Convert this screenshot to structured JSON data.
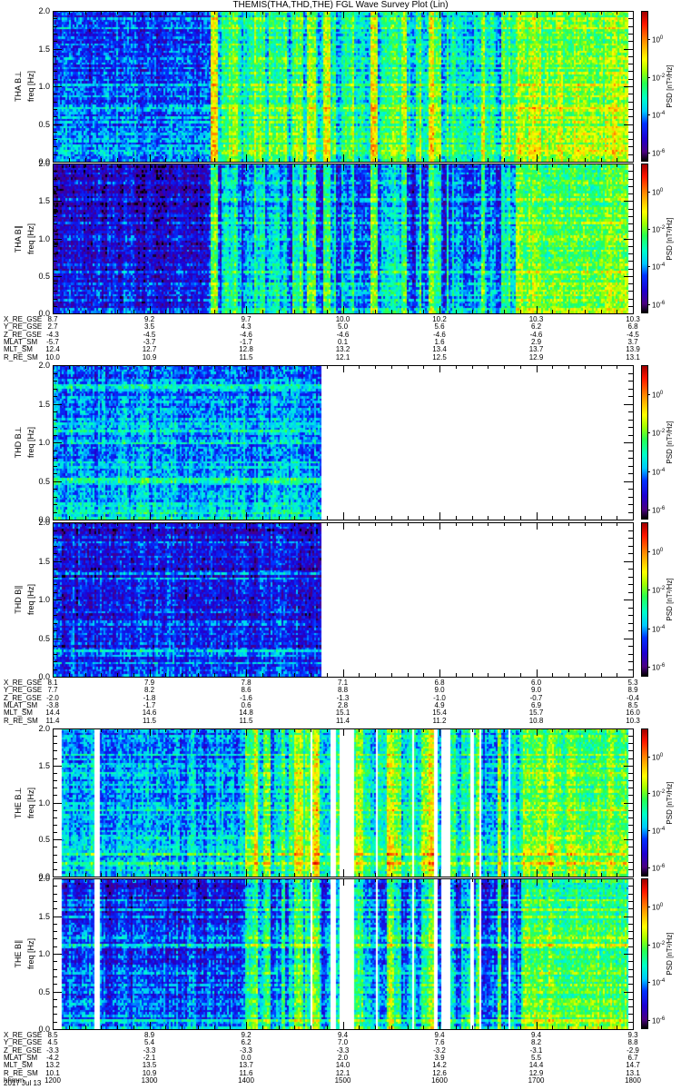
{
  "chart_data": {
    "type": "heatmap",
    "title": "THEMIS(THA,THD,THE) FGL Wave Survey Plot (Lin)",
    "xlabel": "hhmm",
    "date": "2017 Jul 13",
    "x_range_hours": [
      12.0,
      18.0
    ],
    "x_ticks": [
      "1200",
      "1300",
      "1400",
      "1500",
      "1600",
      "1700",
      "1800"
    ],
    "colorbar": {
      "label": "PSD [nT²/Hz]",
      "log10_range": [
        -6.5,
        1.5
      ],
      "ticks": [
        {
          "exp": "0",
          "value": 0
        },
        {
          "exp": "-2",
          "value": -2
        },
        {
          "exp": "-4",
          "value": -4
        },
        {
          "exp": "-6",
          "value": -6
        }
      ]
    },
    "panels": [
      {
        "probe": "THA",
        "ylabel": "THA B⊥",
        "unit_label": "freq [Hz]",
        "ylim": [
          0,
          2
        ],
        "yticks": [
          "0.0",
          "0.5",
          "1.0",
          "1.5",
          "2.0"
        ],
        "segments": [
          {
            "start": 12.0,
            "end": 13.63,
            "level": -4.8,
            "spread": 0.3
          },
          {
            "start": 13.63,
            "end": 16.78,
            "level": -2.9,
            "spread": 1.4
          },
          {
            "start": 16.78,
            "end": 17.95,
            "level": -2.3,
            "spread": 0.4
          }
        ]
      },
      {
        "probe": "THA",
        "ylabel": "THA B∥",
        "unit_label": "freq [Hz]",
        "ylim": [
          0,
          2
        ],
        "yticks": [
          "0.0",
          "0.5",
          "1.0",
          "1.5",
          "2.0"
        ],
        "segments": [
          {
            "start": 12.0,
            "end": 13.63,
            "level": -5.5,
            "spread": 0.3
          },
          {
            "start": 13.63,
            "end": 16.78,
            "level": -3.8,
            "spread": 1.5
          },
          {
            "start": 16.78,
            "end": 17.95,
            "level": -2.6,
            "spread": 0.4
          }
        ]
      },
      {
        "probe": "THD",
        "ylabel": "THD B⊥",
        "unit_label": "freq [Hz]",
        "ylim": [
          0,
          2
        ],
        "yticks": [
          "0.0",
          "0.5",
          "1.0",
          "1.5",
          "2.0"
        ],
        "segments": [
          {
            "start": 12.0,
            "end": 14.78,
            "level": -4.3,
            "spread": 0.3
          }
        ]
      },
      {
        "probe": "THD",
        "ylabel": "THD B∥",
        "unit_label": "freq [Hz]",
        "ylim": [
          0,
          2
        ],
        "yticks": [
          "0.0",
          "0.5",
          "1.0",
          "1.5",
          "2.0"
        ],
        "segments": [
          {
            "start": 12.0,
            "end": 14.78,
            "level": -5.3,
            "spread": 0.3
          }
        ]
      },
      {
        "probe": "THE",
        "ylabel": "THE B⊥",
        "unit_label": "freq [Hz]",
        "ylim": [
          0,
          2
        ],
        "yticks": [
          "0.0",
          "0.5",
          "1.0",
          "1.5",
          "2.0"
        ],
        "segments": [
          {
            "start": 12.1,
            "end": 14.0,
            "level": -4.3,
            "spread": 0.4,
            "gaps": 0.03
          },
          {
            "start": 14.0,
            "end": 16.85,
            "level": -3.0,
            "spread": 1.5,
            "gaps": 0.35
          },
          {
            "start": 16.85,
            "end": 17.95,
            "level": -2.4,
            "spread": 0.4
          }
        ]
      },
      {
        "probe": "THE",
        "ylabel": "THE B∥",
        "unit_label": "freq [Hz]",
        "ylim": [
          0,
          2
        ],
        "yticks": [
          "0.0",
          "0.5",
          "1.0",
          "1.5",
          "2.0"
        ],
        "segments": [
          {
            "start": 12.1,
            "end": 14.0,
            "level": -5.0,
            "spread": 0.4,
            "gaps": 0.03
          },
          {
            "start": 14.0,
            "end": 16.85,
            "level": -3.9,
            "spread": 1.5,
            "gaps": 0.35
          },
          {
            "start": 16.85,
            "end": 17.95,
            "level": -2.7,
            "spread": 0.4
          }
        ]
      }
    ],
    "ephemeris": [
      {
        "probe": "THA",
        "rows": [
          {
            "label": "X_RE_GSE",
            "values": [
              "8.7",
              "9.2",
              "9.7",
              "10.0",
              "10.2",
              "10.3",
              "10.3"
            ]
          },
          {
            "label": "Y_RE_GSE",
            "values": [
              "2.7",
              "3.5",
              "4.3",
              "5.0",
              "5.6",
              "6.2",
              "6.8"
            ]
          },
          {
            "label": "Z_RE_GSE",
            "values": [
              "-4.3",
              "-4.5",
              "-4.6",
              "-4.6",
              "-4.6",
              "-4.6",
              "-4.5"
            ]
          },
          {
            "label": "MLAT_SM",
            "values": [
              "-5.7",
              "-3.7",
              "-1.7",
              "0.1",
              "1.6",
              "2.9",
              "3.7"
            ]
          },
          {
            "label": "MLT_SM",
            "values": [
              "12.4",
              "12.7",
              "12.8",
              "13.2",
              "13.4",
              "13.7",
              "13.9"
            ]
          },
          {
            "label": "R_RE_SM",
            "values": [
              "10.0",
              "10.9",
              "11.5",
              "12.1",
              "12.5",
              "12.9",
              "13.1"
            ]
          }
        ]
      },
      {
        "probe": "THD",
        "rows": [
          {
            "label": "X_RE_GSE",
            "values": [
              "8.1",
              "7.9",
              "7.8",
              "7.1",
              "6.8",
              "6.0",
              "5.3"
            ]
          },
          {
            "label": "Y_RE_GSE",
            "values": [
              "7.7",
              "8.2",
              "8.6",
              "8.8",
              "9.0",
              "9.0",
              "8.9"
            ]
          },
          {
            "label": "Z_RE_GSE",
            "values": [
              "-2.0",
              "-1.8",
              "-1.6",
              "-1.3",
              "-1.0",
              "-0.7",
              "-0.4"
            ]
          },
          {
            "label": "MLAT_SM",
            "values": [
              "-3.8",
              "-1.7",
              "0.6",
              "2.8",
              "4.9",
              "6.9",
              "8.5"
            ]
          },
          {
            "label": "MLT_SM",
            "values": [
              "14.4",
              "14.6",
              "14.8",
              "15.1",
              "15.4",
              "15.7",
              "16.0"
            ]
          },
          {
            "label": "R_RE_SM",
            "values": [
              "11.4",
              "11.5",
              "11.5",
              "11.4",
              "11.2",
              "10.8",
              "10.3"
            ]
          }
        ]
      },
      {
        "probe": "THE",
        "rows": [
          {
            "label": "X_RE_GSE",
            "values": [
              "8.5",
              "8.9",
              "9.2",
              "9.4",
              "9.4",
              "9.4",
              "9.3"
            ]
          },
          {
            "label": "Y_RE_GSE",
            "values": [
              "4.5",
              "5.4",
              "6.2",
              "7.0",
              "7.6",
              "8.2",
              "8.8"
            ]
          },
          {
            "label": "Z_RE_GSE",
            "values": [
              "-3.3",
              "-3.3",
              "-3.3",
              "-3.3",
              "-3.2",
              "-3.1",
              "-2.9"
            ]
          },
          {
            "label": "MLAT_SM",
            "values": [
              "-4.2",
              "-2.1",
              "0.0",
              "2.0",
              "3.9",
              "5.5",
              "6.7"
            ]
          },
          {
            "label": "MLT_SM",
            "values": [
              "13.2",
              "13.5",
              "13.7",
              "14.0",
              "14.2",
              "14.4",
              "14.7"
            ]
          },
          {
            "label": "R_RE_SM",
            "values": [
              "10.1",
              "10.9",
              "11.6",
              "12.1",
              "12.6",
              "12.9",
              "13.1"
            ]
          },
          {
            "label": "hhmm",
            "values": [
              "1200",
              "1300",
              "1400",
              "1500",
              "1600",
              "1700",
              "1800"
            ]
          }
        ]
      }
    ]
  }
}
